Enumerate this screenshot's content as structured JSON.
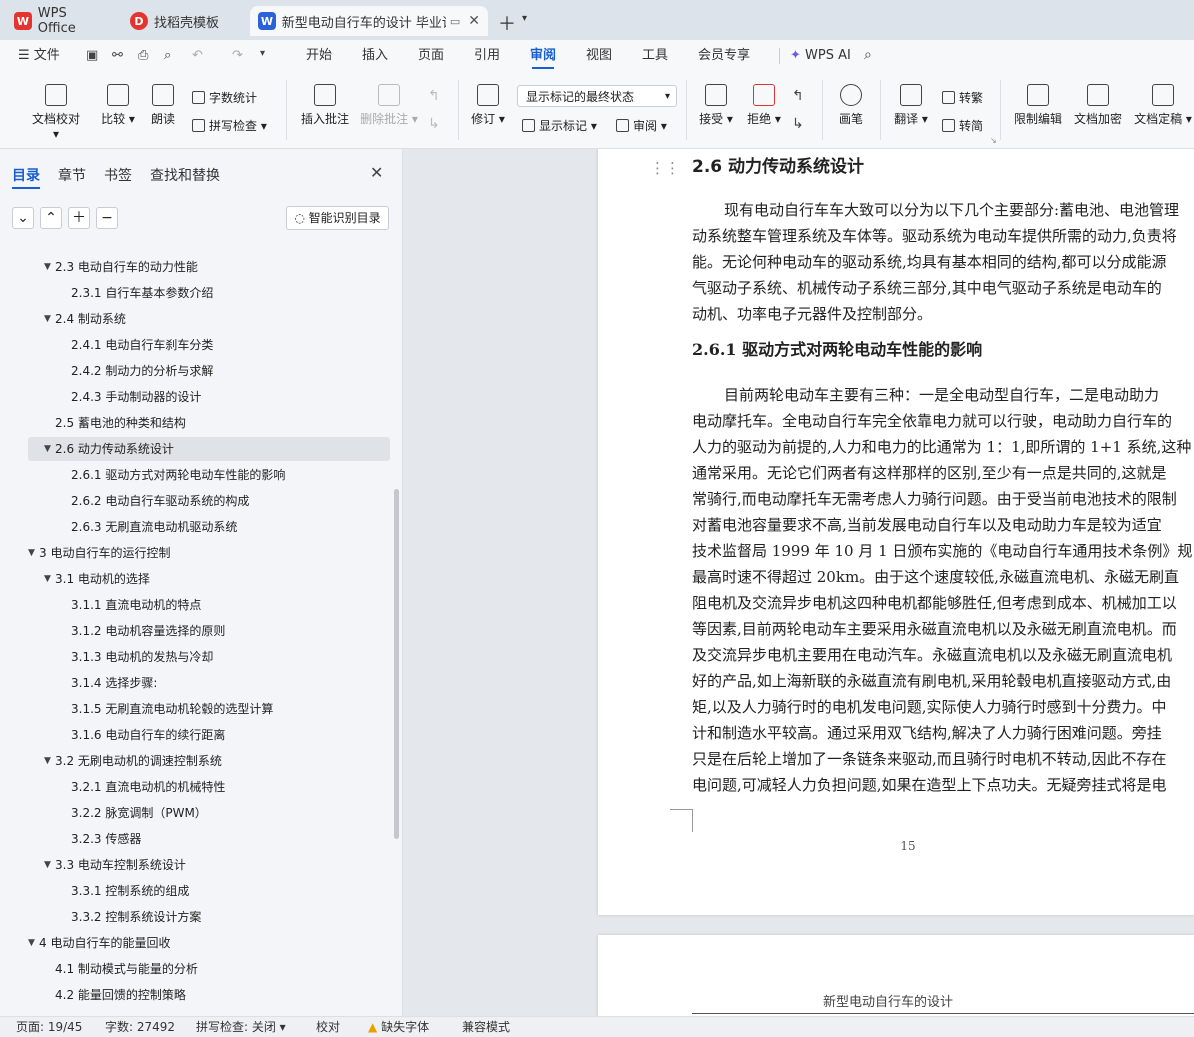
{
  "tabs": [
    {
      "label": "WPS Office"
    },
    {
      "label": "找稻壳模板"
    },
    {
      "label": "新型电动自行车的设计 毕业论"
    }
  ],
  "menubar": {
    "file": "文件",
    "items": [
      "开始",
      "插入",
      "页面",
      "引用",
      "审阅",
      "视图",
      "工具",
      "会员专享"
    ],
    "selected": "审阅",
    "wps_ai": "WPS AI"
  },
  "ribbon": {
    "doc_check": "文档校对",
    "compare": "比较",
    "read_aloud": "朗读",
    "word_count": "字数统计",
    "spell_check": "拼写检查",
    "insert_comment": "插入批注",
    "delete_comment": "删除批注",
    "track_changes": "修订",
    "markup_state": "显示标记的最终状态",
    "show_markup": "显示标记",
    "review_pane": "审阅",
    "accept": "接受",
    "reject": "拒绝",
    "pen": "画笔",
    "translate": "翻译",
    "to_traditional": "转繁",
    "to_simplified": "转简",
    "restrict_edit": "限制编辑",
    "encrypt": "文档加密",
    "finalize": "文档定稿"
  },
  "sidebar": {
    "tabs": [
      "目录",
      "章节",
      "书签",
      "查找和替换"
    ],
    "selected_tab": "目录",
    "smart_toc": "智能识别目录",
    "toc": [
      {
        "text": "2.3  电动自行车的动力性能",
        "level": 2,
        "arrow": true
      },
      {
        "text": "2.3.1  自行车基本参数介绍",
        "level": 3,
        "arrow": false
      },
      {
        "text": "2.4  制动系统",
        "level": 2,
        "arrow": true
      },
      {
        "text": "2.4.1  电动自行车刹车分类",
        "level": 3,
        "arrow": false
      },
      {
        "text": "2.4.2  制动力的分析与求解",
        "level": 3,
        "arrow": false
      },
      {
        "text": "2.4.3  手动制动器的设计",
        "level": 3,
        "arrow": false
      },
      {
        "text": "2.5  蓄电池的种类和结构",
        "level": 2,
        "arrow": false
      },
      {
        "text": "2.6  动力传动系统设计",
        "level": 2,
        "arrow": true,
        "selected": true
      },
      {
        "text": "2.6.1  驱动方式对两轮电动车性能的影响",
        "level": 3,
        "arrow": false
      },
      {
        "text": "2.6.2  电动自行车驱动系统的构成",
        "level": 3,
        "arrow": false
      },
      {
        "text": "2.6.3  无刷直流电动机驱动系统",
        "level": 3,
        "arrow": false
      },
      {
        "text": "3  电动自行车的运行控制",
        "level": 1,
        "arrow": true
      },
      {
        "text": "3.1  电动机的选择",
        "level": 2,
        "arrow": true
      },
      {
        "text": "3.1.1  直流电动机的特点",
        "level": 3,
        "arrow": false
      },
      {
        "text": "3.1.2  电动机容量选择的原则",
        "level": 3,
        "arrow": false
      },
      {
        "text": "3.1.3  电动机的发热与冷却",
        "level": 3,
        "arrow": false
      },
      {
        "text": "3.1.4  选择步骤:",
        "level": 3,
        "arrow": false
      },
      {
        "text": "3.1.5  无刷直流电动机轮毂的选型计算",
        "level": 3,
        "arrow": false
      },
      {
        "text": "3.1.6  电动自行车的续行距离",
        "level": 3,
        "arrow": false
      },
      {
        "text": "3.2  无刷电动机的调速控制系统",
        "level": 2,
        "arrow": true
      },
      {
        "text": "3.2.1  直流电动机的机械特性",
        "level": 3,
        "arrow": false
      },
      {
        "text": "3.2.2  脉宽调制（PWM）",
        "level": 3,
        "arrow": false
      },
      {
        "text": "3.2.3  传感器",
        "level": 3,
        "arrow": false
      },
      {
        "text": "3.3  电动车控制系统设计",
        "level": 2,
        "arrow": true
      },
      {
        "text": "3.3.1  控制系统的组成",
        "level": 3,
        "arrow": false
      },
      {
        "text": "3.3.2  控制系统设计方案",
        "level": 3,
        "arrow": false
      },
      {
        "text": "4  电动自行车的能量回收",
        "level": 1,
        "arrow": true
      },
      {
        "text": "4.1  制动模式与能量的分析",
        "level": 2,
        "arrow": false
      },
      {
        "text": "4.2  能量回馈的控制策略",
        "level": 2,
        "arrow": false
      }
    ]
  },
  "document": {
    "heading": "2.6  动力传动系统设计",
    "para1": [
      "现有电动自行车车大致可以分为以下几个主要部分:蓄电池、电池管理",
      "动系统整车管理系统及车体等。驱动系统为电动车提供所需的动力,负责将",
      "能。无论何种电动车的驱动系统,均具有基本相同的结构,都可以分成能源",
      "气驱动子系统、机械传动子系统三部分,其中电气驱动子系统是电动车的",
      "动机、功率电子元器件及控制部分。"
    ],
    "subheading": "2.6.1  驱动方式对两轮电动车性能的影响",
    "para2": [
      "目前两轮电动车主要有三种：一是全电动型自行车，二是电动助力",
      "电动摩托车。全电动自行车完全依靠电力就可以行驶，电动助力自行车的",
      "人力的驱动为前提的,人力和电力的比通常为 1：1,即所谓的 1+1 系统,这种",
      "通常采用。无论它们两者有这样那样的区别,至少有一点是共同的,这就是",
      "常骑行,而电动摩托车无需考虑人力骑行问题。由于受当前电池技术的限制",
      "对蓄电池容量要求不高,当前发展电动自行车以及电动助力车是较为适宜",
      "技术监督局 1999 年 10 月 1 日颁布实施的《电动自行车通用技术条例》规",
      "最高时速不得超过 20km。由于这个速度较低,永磁直流电机、永磁无刷直",
      "阻电机及交流异步电机这四种电机都能够胜任,但考虑到成本、机械加工以",
      "等因素,目前两轮电动车主要采用永磁直流电机以及永磁无刷直流电机。而",
      "及交流异步电机主要用在电动汽车。永磁直流电机以及永磁无刷直流电机",
      "好的产品,如上海新联的永磁直流有刷电机,采用轮毂电机直接驱动方式,由",
      "矩,以及人力骑行时的电机发电问题,实际使人力骑行时感到十分费力。中",
      "计和制造水平较高。通过采用双飞结构,解决了人力骑行困难问题。旁挂",
      "只是在后轮上增加了一条链条来驱动,而且骑行时电机不转动,因此不存在",
      "电问题,可减轻人力负担问题,如果在造型上下点功夫。无疑旁挂式将是电"
    ],
    "page_number": "15",
    "next_page_header": "新型电动自行车的设计"
  },
  "statusbar": {
    "page": "页面: 19/45",
    "words": "字数: 27492",
    "spell": "拼写检查: 关闭",
    "proof": "校对",
    "missing_font": "缺失字体",
    "compat": "兼容模式"
  }
}
